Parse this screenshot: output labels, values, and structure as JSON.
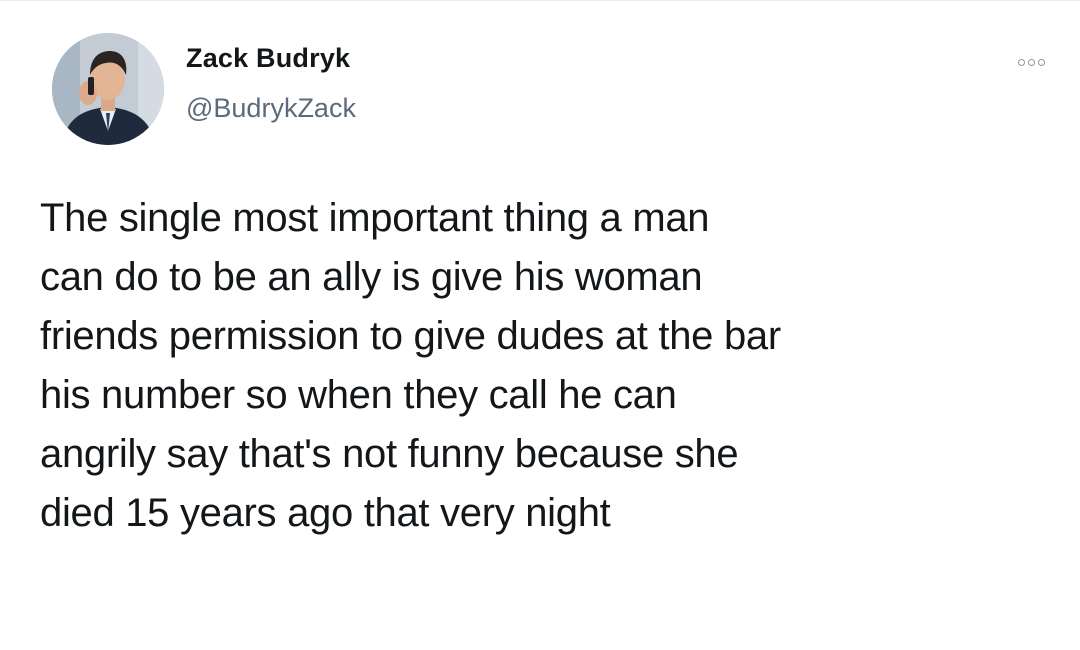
{
  "author": {
    "display_name": "Zack Budryk",
    "handle": "@BudrykZack",
    "avatar_icon": "profile-photo-man-on-phone"
  },
  "more_icon": "more-options-icon",
  "tweet_lines": [
    "The single most important thing a man",
    "can do to be an ally is give his woman",
    "friends permission to give dudes at the bar",
    "his number so when they call he can",
    "angrily say that's not funny because she",
    "died 15 years ago that very night"
  ],
  "colors": {
    "text": "#14171a",
    "handle": "#5b6b7a",
    "icon": "#8b98a5"
  }
}
